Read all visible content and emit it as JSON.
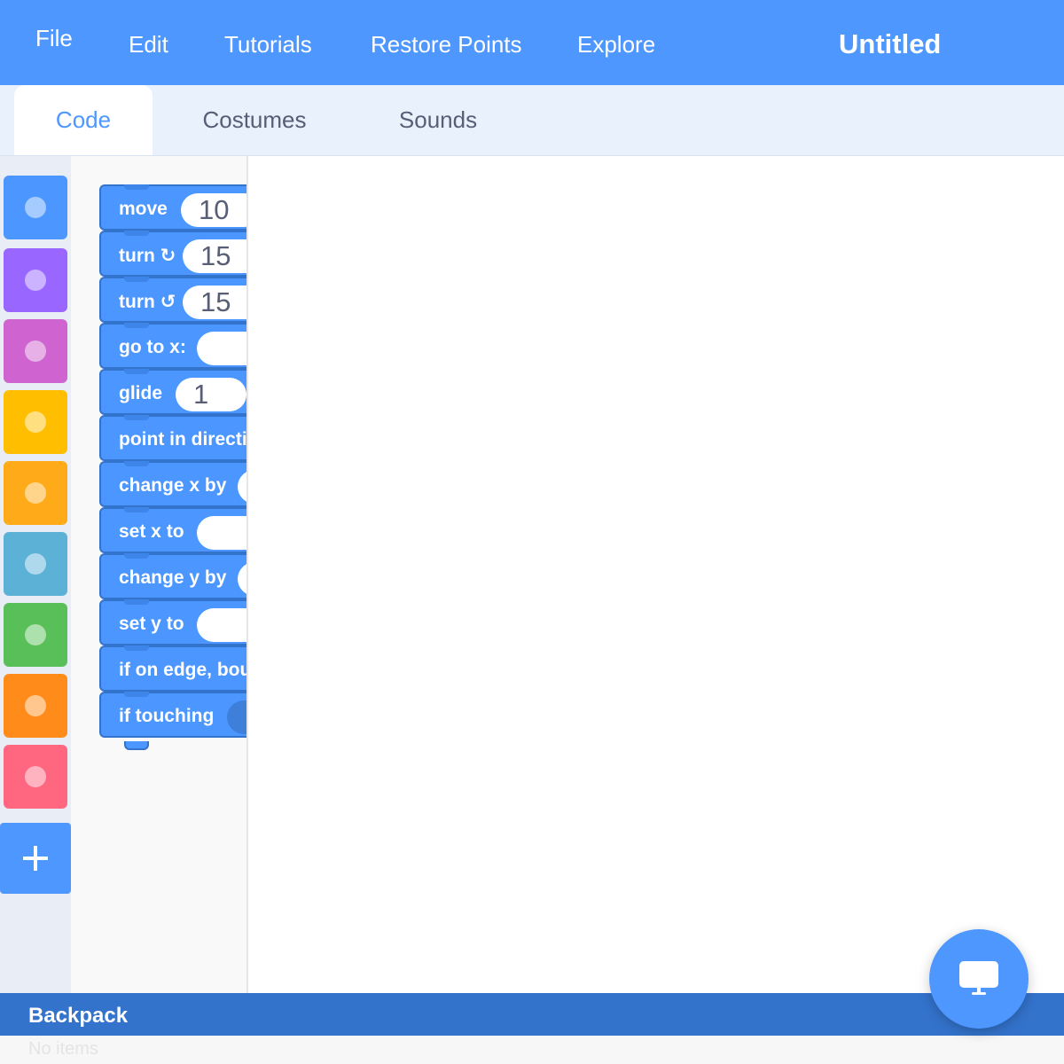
{
  "menubar": {
    "items": [
      "File",
      "Edit",
      "Tutorials",
      "Restore Points",
      "Explore"
    ],
    "project_title": "Untitled",
    "color": "#4d97ff"
  },
  "tabs": [
    {
      "label": "Code",
      "active": true
    },
    {
      "label": "Costumes",
      "active": false
    },
    {
      "label": "Sounds",
      "active": false
    }
  ],
  "categories": [
    {
      "icon": "motion-category-icon",
      "color": "#4c97ff"
    },
    {
      "icon": "looks-category-icon",
      "color": "#9966ff"
    },
    {
      "icon": "sound-category-icon",
      "color": "#cf63cf"
    },
    {
      "icon": "events-category-icon",
      "color": "#ffbf00"
    },
    {
      "icon": "control-category-icon",
      "color": "#ffab19"
    },
    {
      "icon": "sensing-category-icon",
      "color": "#5cb1d6"
    },
    {
      "icon": "operators-category-icon",
      "color": "#59c059"
    },
    {
      "icon": "variables-category-icon",
      "color": "#ff8c1a"
    },
    {
      "icon": "my-blocks-category-icon",
      "color": "#ff6680"
    }
  ],
  "add_extension_icon": "plus-icon",
  "blocks": [
    {
      "label": "move",
      "input": "10"
    },
    {
      "label": "turn ↻",
      "input": "15"
    },
    {
      "label": "turn ↺",
      "input": "15"
    },
    {
      "label": "go to x:",
      "input": ""
    },
    {
      "label": "glide",
      "input": "1"
    },
    {
      "label": "point in directi"
    },
    {
      "label": "change x by",
      "input": ""
    },
    {
      "label": "set x to",
      "input": ""
    },
    {
      "label": "change y by",
      "input": ""
    },
    {
      "label": "set y to",
      "input": ""
    },
    {
      "label": "if on edge, bou"
    },
    {
      "label": "if touching",
      "boolean": true
    }
  ],
  "backpack": {
    "title": "Backpack",
    "empty_text": "No items"
  },
  "stage_button_icon": "monitor-icon"
}
